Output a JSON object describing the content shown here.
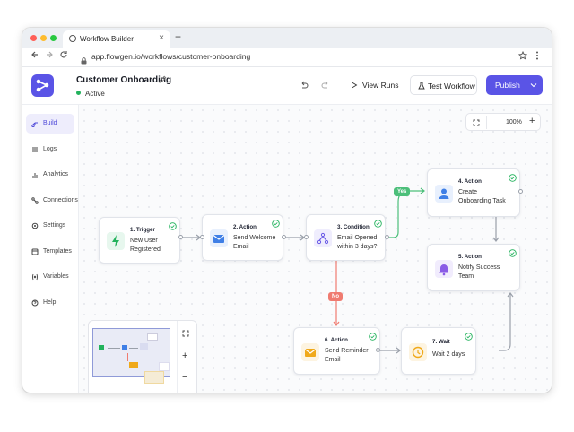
{
  "browser": {
    "tab_title": "Workflow Builder",
    "tab_close": "×",
    "new_tab": "+",
    "url": "app.flowgen.io/workflows/customer-onboarding",
    "traffic_colors": [
      "#ff5f57",
      "#febc2e",
      "#28c840"
    ]
  },
  "header": {
    "workflow_name": "Customer Onboarding",
    "status": "Active",
    "view_runs": "View Runs",
    "test_workflow": "Test Workflow",
    "publish": "Publish",
    "accent": "#5a54e6"
  },
  "sidebar": {
    "items": [
      {
        "label": "Build",
        "icon": "build-icon",
        "active": true
      },
      {
        "label": "Logs",
        "icon": "logs-icon",
        "active": false
      },
      {
        "label": "Analytics",
        "icon": "analytics-icon",
        "active": false
      },
      {
        "label": "Connections",
        "icon": "connections-icon",
        "active": false
      },
      {
        "label": "Settings",
        "icon": "settings-icon",
        "active": false
      },
      {
        "label": "Templates",
        "icon": "templates-icon",
        "active": false
      },
      {
        "label": "Variables",
        "icon": "variables-icon",
        "active": false
      },
      {
        "label": "Help",
        "icon": "help-icon",
        "active": false
      }
    ]
  },
  "canvas": {
    "zoom": "100%",
    "zoom_in": "+",
    "zoom_out": "−",
    "nodes": [
      {
        "title": "1. Trigger",
        "line1": "New User",
        "line2": "Registered",
        "icon": "lightning-icon",
        "color": "#22b25c"
      },
      {
        "title": "2. Action",
        "line1": "Send Welcome",
        "line2": "Email",
        "icon": "mail-icon",
        "color": "#3f7fe6"
      },
      {
        "title": "3. Condition",
        "line1": "Email Opened",
        "line2": "within 3 days?",
        "icon": "branch-icon",
        "color": "#6a5be6"
      },
      {
        "title": "4. Action",
        "line1": "Create",
        "line2": "Onboarding Task",
        "icon": "user-icon",
        "color": "#3f7fe6"
      },
      {
        "title": "5. Action",
        "line1": "Notify Success",
        "line2": "Team",
        "icon": "bell-icon",
        "color": "#8a5be6"
      },
      {
        "title": "6. Action",
        "line1": "Send Reminder",
        "line2": "Email",
        "icon": "mail-icon",
        "color": "#f0a91a"
      },
      {
        "title": "7. Wait",
        "line1": "Wait 2 days",
        "line2": "",
        "icon": "clock-icon",
        "color": "#f0a91a"
      }
    ],
    "yes_label": "Yes",
    "no_label": "No",
    "yes_color": "#4cbf7a",
    "no_color": "#ef7b70"
  },
  "minimap": {
    "zoom_in": "+",
    "zoom_out": "−"
  }
}
